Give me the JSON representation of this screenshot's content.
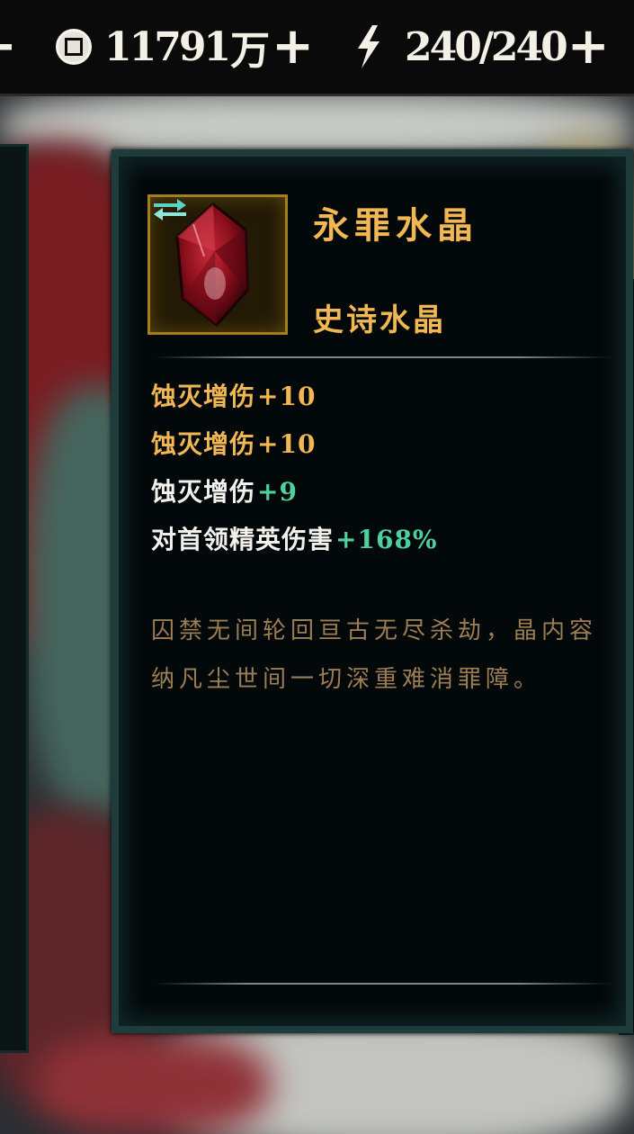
{
  "resources": {
    "coin_value": "11791",
    "coin_unit": "万",
    "energy_value": "240/240"
  },
  "item": {
    "name": "永罪水晶",
    "rarity": "史诗水晶",
    "stats": [
      {
        "label": "蚀灭增伤",
        "value": "+10"
      },
      {
        "label": "蚀灭增伤",
        "value": "+10"
      },
      {
        "label": "蚀灭增伤",
        "value": "+9"
      },
      {
        "label": "对首领精英伤害",
        "value": "+168%"
      }
    ],
    "description": "囚禁无间轮回亘古无尽杀劫，晶内容纳凡尘世间一切深重难消罪障。"
  },
  "colors": {
    "gold": "#f0b752",
    "green": "#4fcf9c",
    "white": "#f2f1ec",
    "desc": "#9c7e54",
    "crystal": "#8e0f1d"
  },
  "icons": [
    "coin-icon",
    "energy-bolt-icon",
    "plus-icon",
    "crystal-icon",
    "swap-icon"
  ]
}
